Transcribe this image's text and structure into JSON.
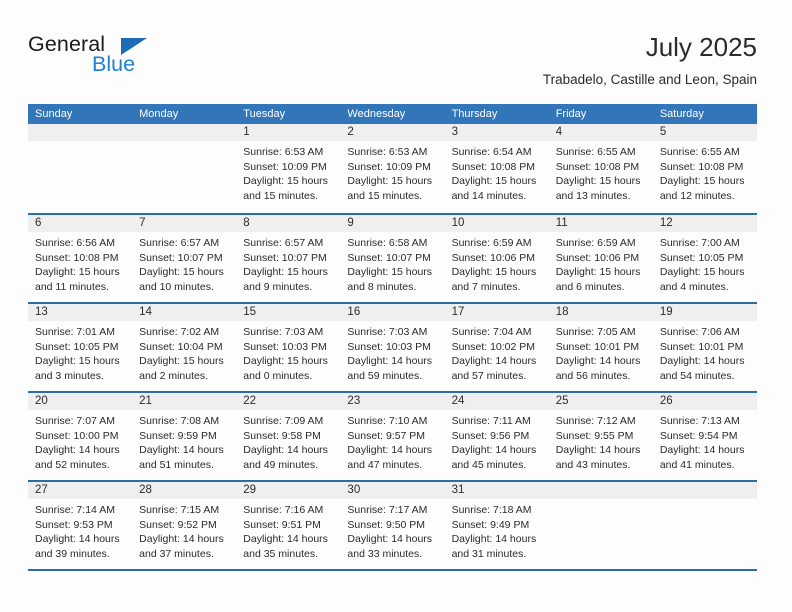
{
  "brand": {
    "name_top": "General",
    "name_bottom": "Blue",
    "accent_color": "#1e7fd4",
    "triangle_color": "#1e6cb5"
  },
  "header": {
    "title": "July 2025",
    "subtitle": "Trabadelo, Castille and Leon, Spain"
  },
  "theme": {
    "header_blue": "#3275b8",
    "rule_blue": "#2e6da4",
    "daynum_band": "#efefef",
    "page_background": "#fdfdfd"
  },
  "weekdays": [
    "Sunday",
    "Monday",
    "Tuesday",
    "Wednesday",
    "Thursday",
    "Friday",
    "Saturday"
  ],
  "weeks": [
    [
      {
        "day": "",
        "sunrise": "",
        "sunset": "",
        "daylight_1": "",
        "daylight_2": ""
      },
      {
        "day": "",
        "sunrise": "",
        "sunset": "",
        "daylight_1": "",
        "daylight_2": ""
      },
      {
        "day": "1",
        "sunrise": "Sunrise: 6:53 AM",
        "sunset": "Sunset: 10:09 PM",
        "daylight_1": "Daylight: 15 hours",
        "daylight_2": "and 15 minutes."
      },
      {
        "day": "2",
        "sunrise": "Sunrise: 6:53 AM",
        "sunset": "Sunset: 10:09 PM",
        "daylight_1": "Daylight: 15 hours",
        "daylight_2": "and 15 minutes."
      },
      {
        "day": "3",
        "sunrise": "Sunrise: 6:54 AM",
        "sunset": "Sunset: 10:08 PM",
        "daylight_1": "Daylight: 15 hours",
        "daylight_2": "and 14 minutes."
      },
      {
        "day": "4",
        "sunrise": "Sunrise: 6:55 AM",
        "sunset": "Sunset: 10:08 PM",
        "daylight_1": "Daylight: 15 hours",
        "daylight_2": "and 13 minutes."
      },
      {
        "day": "5",
        "sunrise": "Sunrise: 6:55 AM",
        "sunset": "Sunset: 10:08 PM",
        "daylight_1": "Daylight: 15 hours",
        "daylight_2": "and 12 minutes."
      }
    ],
    [
      {
        "day": "6",
        "sunrise": "Sunrise: 6:56 AM",
        "sunset": "Sunset: 10:08 PM",
        "daylight_1": "Daylight: 15 hours",
        "daylight_2": "and 11 minutes."
      },
      {
        "day": "7",
        "sunrise": "Sunrise: 6:57 AM",
        "sunset": "Sunset: 10:07 PM",
        "daylight_1": "Daylight: 15 hours",
        "daylight_2": "and 10 minutes."
      },
      {
        "day": "8",
        "sunrise": "Sunrise: 6:57 AM",
        "sunset": "Sunset: 10:07 PM",
        "daylight_1": "Daylight: 15 hours",
        "daylight_2": "and 9 minutes."
      },
      {
        "day": "9",
        "sunrise": "Sunrise: 6:58 AM",
        "sunset": "Sunset: 10:07 PM",
        "daylight_1": "Daylight: 15 hours",
        "daylight_2": "and 8 minutes."
      },
      {
        "day": "10",
        "sunrise": "Sunrise: 6:59 AM",
        "sunset": "Sunset: 10:06 PM",
        "daylight_1": "Daylight: 15 hours",
        "daylight_2": "and 7 minutes."
      },
      {
        "day": "11",
        "sunrise": "Sunrise: 6:59 AM",
        "sunset": "Sunset: 10:06 PM",
        "daylight_1": "Daylight: 15 hours",
        "daylight_2": "and 6 minutes."
      },
      {
        "day": "12",
        "sunrise": "Sunrise: 7:00 AM",
        "sunset": "Sunset: 10:05 PM",
        "daylight_1": "Daylight: 15 hours",
        "daylight_2": "and 4 minutes."
      }
    ],
    [
      {
        "day": "13",
        "sunrise": "Sunrise: 7:01 AM",
        "sunset": "Sunset: 10:05 PM",
        "daylight_1": "Daylight: 15 hours",
        "daylight_2": "and 3 minutes."
      },
      {
        "day": "14",
        "sunrise": "Sunrise: 7:02 AM",
        "sunset": "Sunset: 10:04 PM",
        "daylight_1": "Daylight: 15 hours",
        "daylight_2": "and 2 minutes."
      },
      {
        "day": "15",
        "sunrise": "Sunrise: 7:03 AM",
        "sunset": "Sunset: 10:03 PM",
        "daylight_1": "Daylight: 15 hours",
        "daylight_2": "and 0 minutes."
      },
      {
        "day": "16",
        "sunrise": "Sunrise: 7:03 AM",
        "sunset": "Sunset: 10:03 PM",
        "daylight_1": "Daylight: 14 hours",
        "daylight_2": "and 59 minutes."
      },
      {
        "day": "17",
        "sunrise": "Sunrise: 7:04 AM",
        "sunset": "Sunset: 10:02 PM",
        "daylight_1": "Daylight: 14 hours",
        "daylight_2": "and 57 minutes."
      },
      {
        "day": "18",
        "sunrise": "Sunrise: 7:05 AM",
        "sunset": "Sunset: 10:01 PM",
        "daylight_1": "Daylight: 14 hours",
        "daylight_2": "and 56 minutes."
      },
      {
        "day": "19",
        "sunrise": "Sunrise: 7:06 AM",
        "sunset": "Sunset: 10:01 PM",
        "daylight_1": "Daylight: 14 hours",
        "daylight_2": "and 54 minutes."
      }
    ],
    [
      {
        "day": "20",
        "sunrise": "Sunrise: 7:07 AM",
        "sunset": "Sunset: 10:00 PM",
        "daylight_1": "Daylight: 14 hours",
        "daylight_2": "and 52 minutes."
      },
      {
        "day": "21",
        "sunrise": "Sunrise: 7:08 AM",
        "sunset": "Sunset: 9:59 PM",
        "daylight_1": "Daylight: 14 hours",
        "daylight_2": "and 51 minutes."
      },
      {
        "day": "22",
        "sunrise": "Sunrise: 7:09 AM",
        "sunset": "Sunset: 9:58 PM",
        "daylight_1": "Daylight: 14 hours",
        "daylight_2": "and 49 minutes."
      },
      {
        "day": "23",
        "sunrise": "Sunrise: 7:10 AM",
        "sunset": "Sunset: 9:57 PM",
        "daylight_1": "Daylight: 14 hours",
        "daylight_2": "and 47 minutes."
      },
      {
        "day": "24",
        "sunrise": "Sunrise: 7:11 AM",
        "sunset": "Sunset: 9:56 PM",
        "daylight_1": "Daylight: 14 hours",
        "daylight_2": "and 45 minutes."
      },
      {
        "day": "25",
        "sunrise": "Sunrise: 7:12 AM",
        "sunset": "Sunset: 9:55 PM",
        "daylight_1": "Daylight: 14 hours",
        "daylight_2": "and 43 minutes."
      },
      {
        "day": "26",
        "sunrise": "Sunrise: 7:13 AM",
        "sunset": "Sunset: 9:54 PM",
        "daylight_1": "Daylight: 14 hours",
        "daylight_2": "and 41 minutes."
      }
    ],
    [
      {
        "day": "27",
        "sunrise": "Sunrise: 7:14 AM",
        "sunset": "Sunset: 9:53 PM",
        "daylight_1": "Daylight: 14 hours",
        "daylight_2": "and 39 minutes."
      },
      {
        "day": "28",
        "sunrise": "Sunrise: 7:15 AM",
        "sunset": "Sunset: 9:52 PM",
        "daylight_1": "Daylight: 14 hours",
        "daylight_2": "and 37 minutes."
      },
      {
        "day": "29",
        "sunrise": "Sunrise: 7:16 AM",
        "sunset": "Sunset: 9:51 PM",
        "daylight_1": "Daylight: 14 hours",
        "daylight_2": "and 35 minutes."
      },
      {
        "day": "30",
        "sunrise": "Sunrise: 7:17 AM",
        "sunset": "Sunset: 9:50 PM",
        "daylight_1": "Daylight: 14 hours",
        "daylight_2": "and 33 minutes."
      },
      {
        "day": "31",
        "sunrise": "Sunrise: 7:18 AM",
        "sunset": "Sunset: 9:49 PM",
        "daylight_1": "Daylight: 14 hours",
        "daylight_2": "and 31 minutes."
      },
      {
        "day": "",
        "sunrise": "",
        "sunset": "",
        "daylight_1": "",
        "daylight_2": ""
      },
      {
        "day": "",
        "sunrise": "",
        "sunset": "",
        "daylight_1": "",
        "daylight_2": ""
      }
    ]
  ]
}
